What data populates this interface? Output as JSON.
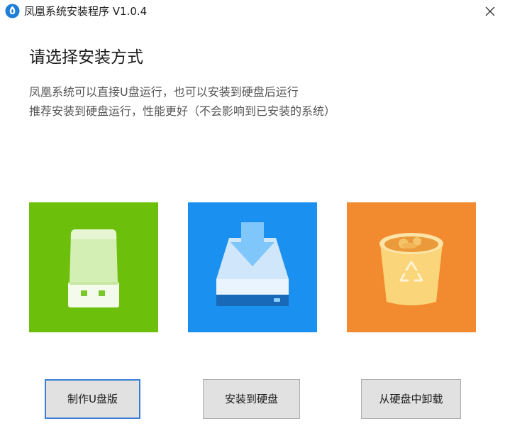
{
  "window": {
    "title": "凤凰系统安装程序 V1.0.4"
  },
  "header": {
    "heading": "请选择安装方式",
    "description_lines": [
      "凤凰系统可以直接U盘运行，也可以安装到硬盘后运行",
      "推荐安装到硬盘运行，性能更好（不会影响到已安装的系统）"
    ]
  },
  "options": [
    {
      "icon": "usb-drive-icon",
      "tile_color": "#6cc00c",
      "button_label": "制作U盘版",
      "focused": true
    },
    {
      "icon": "install-to-disk-icon",
      "tile_color": "#1a90f0",
      "button_label": "安装到硬盘",
      "focused": false
    },
    {
      "icon": "recycle-bin-icon",
      "tile_color": "#f28a30",
      "button_label": "从硬盘中卸载",
      "focused": false
    }
  ],
  "colors": {
    "focus_border": "#3a7fd6",
    "button_bg": "#e1e1e1"
  }
}
